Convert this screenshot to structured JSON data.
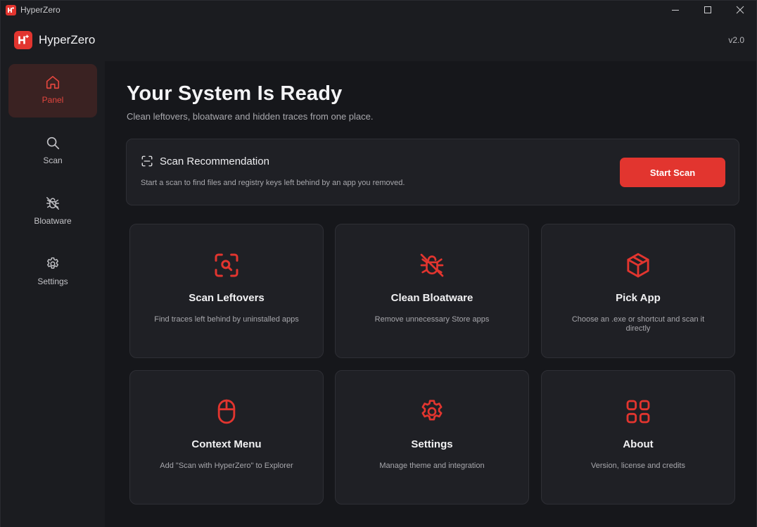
{
  "window": {
    "title": "HyperZero"
  },
  "header": {
    "app_name": "HyperZero",
    "version": "v2.0"
  },
  "sidebar": {
    "items": [
      {
        "label": "Panel",
        "icon": "home-icon",
        "active": true
      },
      {
        "label": "Scan",
        "icon": "search-icon",
        "active": false
      },
      {
        "label": "Bloatware",
        "icon": "bug-off-icon",
        "active": false
      },
      {
        "label": "Settings",
        "icon": "gear-icon",
        "active": false
      }
    ]
  },
  "main": {
    "title": "Your System Is Ready",
    "subtitle": "Clean leftovers, bloatware and hidden traces from one place.",
    "recommendation": {
      "title": "Scan Recommendation",
      "description": "Start a scan to find files and registry keys left behind by an app you removed.",
      "button": "Start Scan"
    },
    "tiles": [
      {
        "title": "Scan Leftovers",
        "description": "Find traces left behind by uninstalled apps",
        "icon": "scan-search-icon"
      },
      {
        "title": "Clean Bloatware",
        "description": "Remove unnecessary Store apps",
        "icon": "bug-off-icon"
      },
      {
        "title": "Pick App",
        "description": "Choose an .exe or shortcut and scan it directly",
        "icon": "package-icon"
      },
      {
        "title": "Context Menu",
        "description": "Add \"Scan with HyperZero\" to Explorer",
        "icon": "mouse-icon"
      },
      {
        "title": "Settings",
        "description": "Manage theme and integration",
        "icon": "gear-icon"
      },
      {
        "title": "About",
        "description": "Version, license and credits",
        "icon": "grid-icon"
      }
    ]
  },
  "colors": {
    "accent": "#e2352f",
    "background": "#16171b",
    "panel": "#1b1c20",
    "card": "#1f2025",
    "active_nav": "#3a2222"
  }
}
